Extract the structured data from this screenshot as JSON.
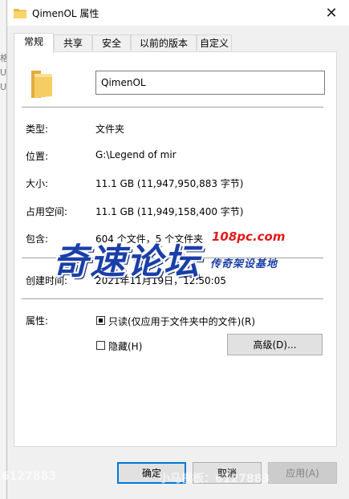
{
  "window": {
    "title": "QimenOL 属性",
    "close_glyph": "✕"
  },
  "background_edge": [
    "格",
    "U",
    "U"
  ],
  "tabs": [
    {
      "label": "常规",
      "active": true
    },
    {
      "label": "共享",
      "active": false
    },
    {
      "label": "安全",
      "active": false
    },
    {
      "label": "以前的版本",
      "active": false
    },
    {
      "label": "自定义",
      "active": false
    }
  ],
  "general": {
    "folder_name": "QimenOL",
    "rows": [
      {
        "label": "类型:",
        "value": "文件夹"
      },
      {
        "label": "位置:",
        "value": "G:\\Legend of mir"
      },
      {
        "label": "大小:",
        "value": "11.1 GB (11,947,950,883 字节)"
      },
      {
        "label": "占用空间:",
        "value": "11.1 GB (11,949,158,400 字节)"
      },
      {
        "label": "包含:",
        "value": "604 个文件，5 个文件夹"
      },
      {
        "label": "创建时间:",
        "value": "2021年11月19日，12:50:05"
      }
    ],
    "attributes_label": "属性:",
    "readonly_label": "只读(仅应用于文件夹中的文件)(R)",
    "readonly_state": "indeterminate",
    "hidden_label": "隐藏(H)",
    "hidden_checked": false,
    "advanced_button": "高级(D)..."
  },
  "footer": {
    "ok": "确定",
    "cancel": "取消",
    "apply": "应用(A)"
  },
  "watermark": {
    "main": "奇速论坛",
    "url": "108pc.com",
    "sub": "传奇架设基地"
  },
  "overlay": {
    "left": "6127883",
    "right": "小马模板：6127883"
  },
  "colors": {
    "accent": "#0078d7",
    "folder": "#f4c95d",
    "watermark_blue": "#1a3fa8",
    "watermark_red": "#e11b1b"
  },
  "icons": {
    "title": "folder-icon",
    "main": "folder-icon"
  }
}
